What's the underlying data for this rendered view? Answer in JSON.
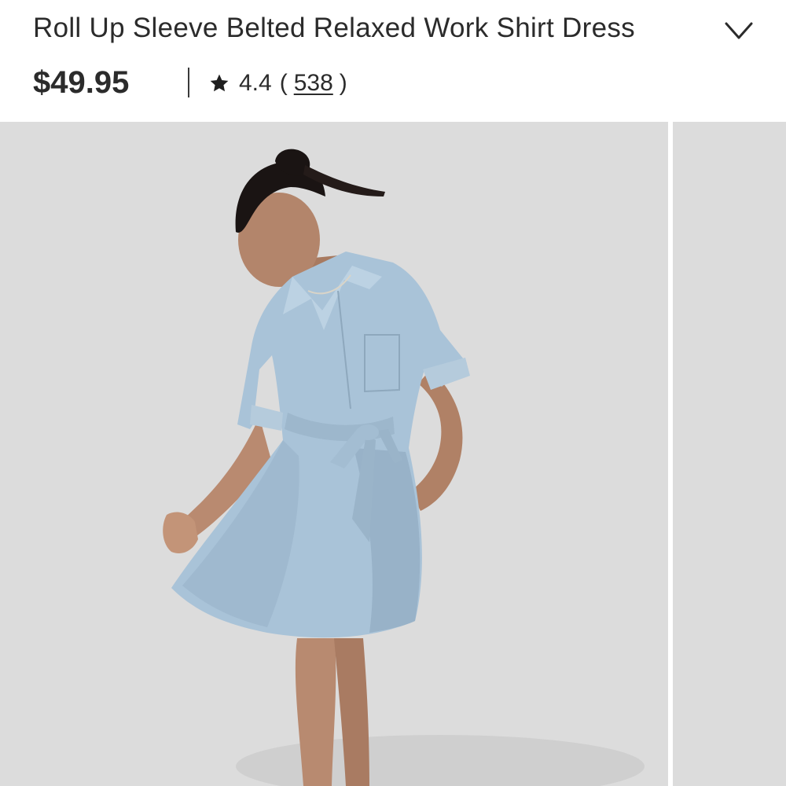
{
  "product": {
    "title": "Roll Up Sleeve Belted Relaxed Work Shirt Dress",
    "price": "$49.95",
    "rating": "4.4",
    "review_count": "538",
    "paren_open": "(",
    "paren_close": ")"
  },
  "icons": {
    "expand": "chevron-down-icon",
    "rating": "star-icon"
  },
  "gallery": {
    "current_image": "model-light-blue-shirt-dress",
    "next_image": "next-product-image-peek"
  },
  "colors": {
    "text": "#2b2b2b",
    "photo_background": "#dcdcdc",
    "dress": "#a9c3d8"
  }
}
